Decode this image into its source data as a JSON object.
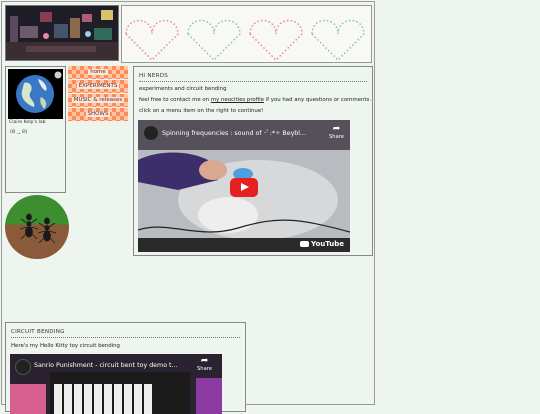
{
  "menu": {
    "items": [
      {
        "label": "home"
      },
      {
        "label": "EXPERIMENTS"
      },
      {
        "label": "MUSIC & releases"
      },
      {
        "label": "SHOWS"
      }
    ]
  },
  "profile": {
    "name": "Claire Kelp's lab",
    "face": "(Ꙩ ‿̩ Ꙩ)"
  },
  "hi_section": {
    "title": "HI NERDS",
    "line1": "experiments and circuit bending",
    "line2_prefix": "feel free to contact me on ",
    "line2_link": "my neocities profile",
    "line2_suffix": " if you had any questions or comments.",
    "line3": "click on a menu item on the right to continue!",
    "video": {
      "title": "Spinning frequencies : sound of ･ﾟ:*✧ Beybl...",
      "share": "Share",
      "brand": "YouTube"
    }
  },
  "circuit_section": {
    "title": "CIRCUIT BENDING",
    "line1": "Here's my Hello Kitty toy circuit bending",
    "video": {
      "title": "Sanrio Punishment - circuit bent toy demo t...",
      "share": "Share"
    }
  },
  "colors": {
    "menu_orange": "#ff8a55",
    "youtube_red": "#e52020",
    "page_bg": "#eef4ee"
  }
}
